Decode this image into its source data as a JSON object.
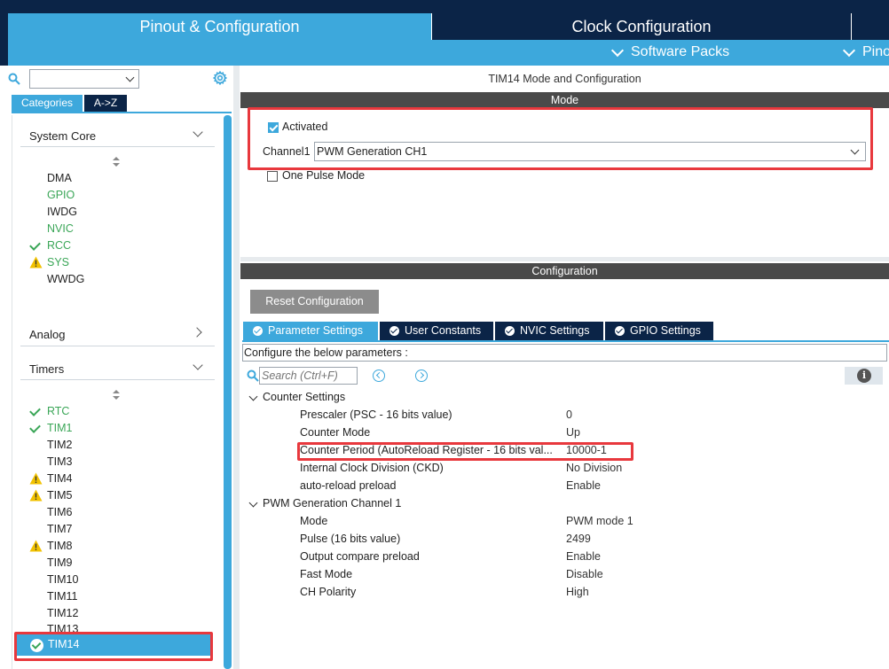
{
  "header": {
    "tab_pinout": "Pinout & Configuration",
    "tab_clock": "Clock Configuration",
    "sub_software_packs": "Software Packs",
    "sub_pinout": "Pinout"
  },
  "sidebar": {
    "search_value": "",
    "tab_categories": "Categories",
    "tab_az": "A->Z",
    "system_core": {
      "label": "System Core",
      "items": [
        {
          "label": "DMA",
          "status": "none"
        },
        {
          "label": "GPIO",
          "status": "green"
        },
        {
          "label": "IWDG",
          "status": "none"
        },
        {
          "label": "NVIC",
          "status": "green"
        },
        {
          "label": "RCC",
          "status": "check"
        },
        {
          "label": "SYS",
          "status": "warning"
        },
        {
          "label": "WWDG",
          "status": "none"
        }
      ]
    },
    "analog": {
      "label": "Analog"
    },
    "timers": {
      "label": "Timers",
      "items": [
        {
          "label": "RTC",
          "status": "check"
        },
        {
          "label": "TIM1",
          "status": "check"
        },
        {
          "label": "TIM2",
          "status": "none"
        },
        {
          "label": "TIM3",
          "status": "none"
        },
        {
          "label": "TIM4",
          "status": "warning"
        },
        {
          "label": "TIM5",
          "status": "warning"
        },
        {
          "label": "TIM6",
          "status": "none"
        },
        {
          "label": "TIM7",
          "status": "none"
        },
        {
          "label": "TIM8",
          "status": "warning"
        },
        {
          "label": "TIM9",
          "status": "none"
        },
        {
          "label": "TIM10",
          "status": "none"
        },
        {
          "label": "TIM11",
          "status": "none"
        },
        {
          "label": "TIM12",
          "status": "none"
        },
        {
          "label": "TIM13",
          "status": "none"
        }
      ],
      "selected": {
        "label": "TIM14",
        "status": "check"
      }
    }
  },
  "main": {
    "title": "TIM14 Mode and Configuration",
    "mode_header": "Mode",
    "activated_label": "Activated",
    "activated_checked": true,
    "channel1_label": "Channel1",
    "channel1_value": "PWM Generation CH1",
    "one_pulse_label": "One Pulse Mode",
    "one_pulse_checked": false,
    "config_header": "Configuration",
    "reset_button": "Reset Configuration",
    "tabs": [
      {
        "label": "Parameter Settings",
        "active": true
      },
      {
        "label": "User Constants",
        "active": false
      },
      {
        "label": "NVIC Settings",
        "active": false
      },
      {
        "label": "GPIO Settings",
        "active": false
      }
    ],
    "configure_text": "Configure the below parameters :",
    "search_placeholder": "Search (Ctrl+F)",
    "groups": [
      {
        "label": "Counter Settings",
        "params": [
          {
            "name": "Prescaler (PSC - 16 bits value)",
            "value": "0"
          },
          {
            "name": "Counter Mode",
            "value": "Up"
          },
          {
            "name": "Counter Period (AutoReload Register - 16 bits val...",
            "value": "10000-1"
          },
          {
            "name": "Internal Clock Division (CKD)",
            "value": "No Division"
          },
          {
            "name": "auto-reload preload",
            "value": "Enable"
          }
        ]
      },
      {
        "label": "PWM Generation Channel 1",
        "params": [
          {
            "name": "Mode",
            "value": "PWM mode 1"
          },
          {
            "name": "Pulse (16 bits value)",
            "value": "2499"
          },
          {
            "name": "Output compare preload",
            "value": "Enable"
          },
          {
            "name": "Fast Mode",
            "value": "Disable"
          },
          {
            "name": "CH Polarity",
            "value": "High"
          }
        ]
      }
    ]
  },
  "colors": {
    "dark_navy": "#0b2447",
    "accent_blue": "#3da8dc",
    "ok_green": "#3aa657",
    "warning_yellow": "#f2c200",
    "highlight_red": "#e8383d"
  }
}
